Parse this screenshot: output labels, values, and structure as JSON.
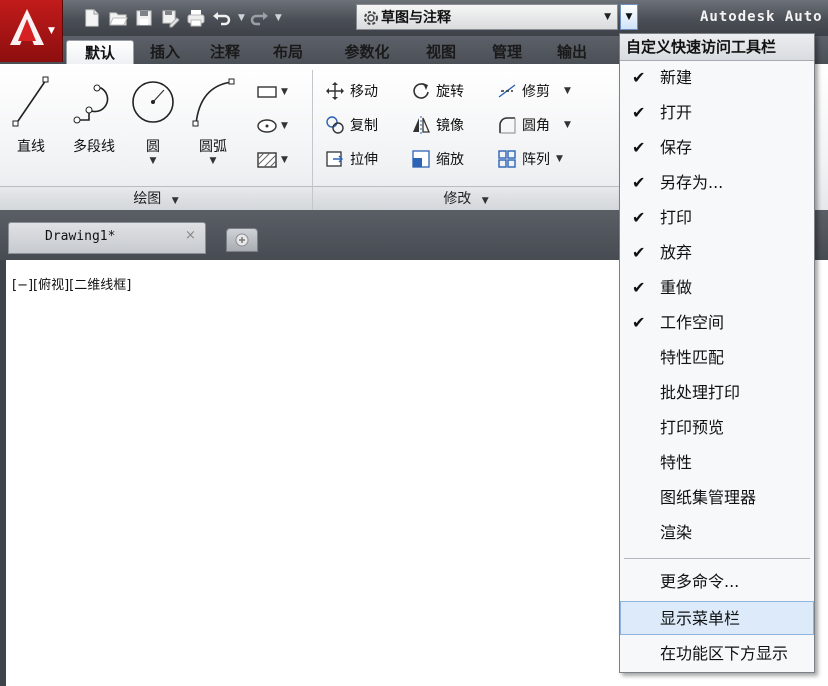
{
  "title_bar": {
    "workspace": "草图与注释",
    "app_title": "Autodesk Auto"
  },
  "ribbon_tabs": [
    "默认",
    "插入",
    "注释",
    "布局",
    "参数化",
    "视图",
    "管理",
    "输出"
  ],
  "ribbon": {
    "draw_panel": {
      "title": "绘图",
      "tools": [
        "直线",
        "多段线",
        "圆",
        "圆弧"
      ]
    },
    "modify_panel": {
      "title": "修改",
      "rows": [
        [
          "移动",
          "旋转",
          "修剪"
        ],
        [
          "复制",
          "镜像",
          "圆角"
        ],
        [
          "拉伸",
          "缩放",
          "阵列"
        ]
      ]
    }
  },
  "document_tab": {
    "name": "Drawing1*",
    "close": "×"
  },
  "viewport_label": "[−][俯视][二维线框]",
  "qat_menu": {
    "header": "自定义快速访问工具栏",
    "checked_items": [
      "新建",
      "打开",
      "保存",
      "另存为...",
      "打印",
      "放弃",
      "重做",
      "工作空间"
    ],
    "unchecked_items": [
      "特性匹配",
      "批处理打印",
      "打印预览",
      "特性",
      "图纸集管理器",
      "渲染"
    ],
    "more_commands": "更多命令...",
    "show_menubar": "显示菜单栏",
    "show_below_ribbon": "在功能区下方显示",
    "check_mark": "✔"
  },
  "colors": {
    "accent_red": "#c21b1b",
    "menu_hover": "#dceaf9"
  }
}
